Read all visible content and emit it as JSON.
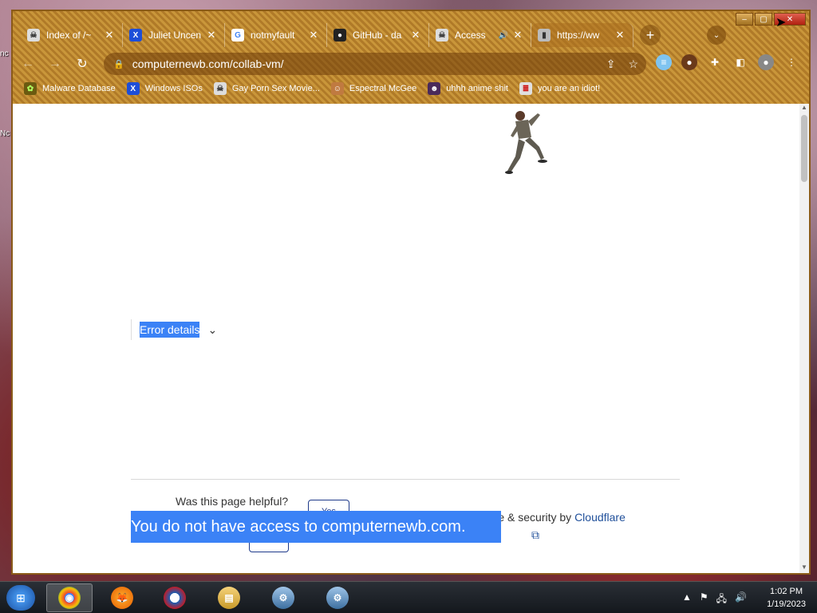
{
  "desktop": {
    "labels": [
      "nc",
      "Nc"
    ]
  },
  "window": {
    "controls": {
      "minimize": "–",
      "maximize": "▢",
      "close": "✕"
    }
  },
  "tabs": [
    {
      "title": "Index of /~",
      "icon": "skull-icon",
      "icon_glyph": "☠",
      "icon_bg": "#ddd",
      "icon_color": "#333",
      "active": false
    },
    {
      "title": "Juliet Uncen",
      "icon": "x-logo-icon",
      "icon_glyph": "X",
      "icon_bg": "#1d4ed8",
      "icon_color": "#fff",
      "active": false
    },
    {
      "title": "notmyfault",
      "icon": "google-icon",
      "icon_glyph": "G",
      "icon_bg": "#fff",
      "icon_color": "#4285f4",
      "active": false
    },
    {
      "title": "GitHub - da",
      "icon": "github-icon",
      "icon_glyph": "●",
      "icon_bg": "#222",
      "icon_color": "#fff",
      "active": false
    },
    {
      "title": "Access",
      "icon": "skull-icon",
      "icon_glyph": "☠",
      "icon_bg": "#ddd",
      "icon_color": "#333",
      "active": false,
      "audio": "🔊"
    },
    {
      "title": "https://ww",
      "icon": "page-icon",
      "icon_glyph": "▮",
      "icon_bg": "#bbb",
      "icon_color": "#333",
      "active": true
    }
  ],
  "new_tab_label": "+",
  "tab_search_label": "⌄",
  "nav": {
    "back": "←",
    "forward": "→",
    "reload": "↻"
  },
  "omnibox": {
    "url": "computernewb.com/collab-vm/",
    "lock": "🔒",
    "share": "⇪",
    "star": "☆"
  },
  "extensions": [
    {
      "name": "trans-flag-icon",
      "glyph": "≡",
      "bg": "#7fc4f0"
    },
    {
      "name": "profile-pic-icon",
      "glyph": "●",
      "bg": "#6b3a1a"
    },
    {
      "name": "extensions-puzzle-icon",
      "glyph": "✚",
      "bg": "transparent"
    },
    {
      "name": "side-panel-icon",
      "glyph": "◧",
      "bg": "transparent"
    },
    {
      "name": "account-icon",
      "glyph": "●",
      "bg": "#888"
    },
    {
      "name": "menu-kebab-icon",
      "glyph": "⋮",
      "bg": "transparent"
    }
  ],
  "bookmarks": [
    {
      "label": "Malware Database",
      "icon": "malware-icon",
      "glyph": "✿",
      "bg": "#6b5a10",
      "color": "#b0ff60"
    },
    {
      "label": "Windows ISOs",
      "icon": "x-logo-icon",
      "glyph": "X",
      "bg": "#1d4ed8",
      "color": "#fff"
    },
    {
      "label": "Gay Porn Sex Movie...",
      "icon": "skull-icon",
      "glyph": "☠",
      "bg": "#ddd",
      "color": "#333"
    },
    {
      "label": "Espectral McGee",
      "icon": "character-icon",
      "glyph": "☺",
      "bg": "#c07a40",
      "color": "#fff"
    },
    {
      "label": "uhhh anime shit",
      "icon": "anime-icon",
      "glyph": "☻",
      "bg": "#4a2a5a",
      "color": "#fff"
    },
    {
      "label": "you are an idiot!",
      "icon": "flag-icon",
      "glyph": "≣",
      "bg": "#e0e0e0",
      "color": "#c00"
    }
  ],
  "page": {
    "error_details": "Error details",
    "error_chevron": "⌄",
    "helpful_question": "Was this page helpful?",
    "yes_button": "Yes",
    "no_button": "No",
    "performance_prefix": "Performance & security by ",
    "cloudflare_link": "Cloudflare",
    "external_link_glyph": "⧉",
    "access_banner": "You do not have access to computernewb.com."
  },
  "scrollbar": {
    "up": "▲",
    "down": "▼"
  },
  "taskbar": {
    "apps": [
      {
        "name": "chrome-icon",
        "glyph": "◉",
        "bg": "radial-gradient(circle,#4285f4 30%,#ea4335 31%,#fbbc05 60%,#34a853 80%)",
        "active": true
      },
      {
        "name": "firefox-icon",
        "glyph": "🦊",
        "bg": "radial-gradient(circle,#ffb02e,#e65c00)",
        "active": false
      },
      {
        "name": "obama-logo-icon",
        "glyph": "◐",
        "bg": "radial-gradient(circle,#fff 30%,#1a5fb4 31%,#c01c28 70%)",
        "active": false
      },
      {
        "name": "file-explorer-icon",
        "glyph": "▤",
        "bg": "linear-gradient(#f5d27a,#c89a2a)",
        "active": false
      },
      {
        "name": "installer-icon",
        "glyph": "⚙",
        "bg": "linear-gradient(#9fc5e8,#3d6fa0)",
        "active": false
      },
      {
        "name": "installer-icon-2",
        "glyph": "⚙",
        "bg": "linear-gradient(#9fc5e8,#3d6fa0)",
        "active": false
      }
    ],
    "tray_chevron": "▲",
    "tray_flag": "⚑",
    "tray_network": "🖧",
    "tray_volume": "🔊",
    "time": "1:02 PM",
    "date": "1/19/2023"
  },
  "cursor": "➤"
}
